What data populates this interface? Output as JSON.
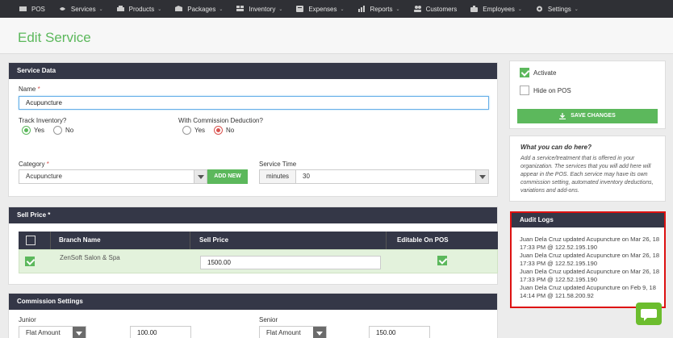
{
  "nav": {
    "items": [
      {
        "label": "POS",
        "icon": "pos-icon",
        "caret": false
      },
      {
        "label": "Services",
        "icon": "services-icon",
        "caret": true
      },
      {
        "label": "Products",
        "icon": "products-icon",
        "caret": true
      },
      {
        "label": "Packages",
        "icon": "packages-icon",
        "caret": true
      },
      {
        "label": "Inventory",
        "icon": "inventory-icon",
        "caret": true
      },
      {
        "label": "Expenses",
        "icon": "expenses-icon",
        "caret": true
      },
      {
        "label": "Reports",
        "icon": "reports-icon",
        "caret": true
      },
      {
        "label": "Customers",
        "icon": "customers-icon",
        "caret": false
      },
      {
        "label": "Employees",
        "icon": "employees-icon",
        "caret": true
      },
      {
        "label": "Settings",
        "icon": "settings-icon",
        "caret": true
      }
    ],
    "caret_glyph": "⌄"
  },
  "page": {
    "title": "Edit Service"
  },
  "service_data": {
    "header": "Service Data",
    "name_label": "Name",
    "required_mark": "*",
    "name_value": "Acupuncture",
    "track_inventory_label": "Track Inventory?",
    "track_yes": "Yes",
    "track_no": "No",
    "commission_deduction_label": "With Commission Deduction?",
    "commission_yes": "Yes",
    "commission_no": "No",
    "category_label": "Category",
    "category_value": "Acupuncture",
    "add_new_label": "ADD NEW",
    "service_time_label": "Service Time",
    "time_unit": "minutes",
    "time_value": "30"
  },
  "sell_price": {
    "header": "Sell Price *",
    "columns": [
      "Branch Name",
      "Sell Price",
      "Editable On POS"
    ],
    "rows": [
      {
        "branch": "ZenSoft Salon & Spa",
        "price": "1500.00"
      }
    ]
  },
  "commission": {
    "header": "Commission Settings",
    "junior_label": "Junior",
    "junior_type": "Flat Amount",
    "junior_value": "100.00",
    "senior_label": "Senior",
    "senior_type": "Flat Amount",
    "senior_value": "150.00"
  },
  "sidebar": {
    "activate_label": "Activate",
    "hide_on_pos_label": "Hide on POS",
    "save_label": "SAVE CHANGES",
    "help_title": "What you can do here?",
    "help_text": "Add a service/treatment that is offered in your organization. The services that you will add here will appear in the POS. Each service may have its own commission setting, automated inventory deductions, variations and add-ons."
  },
  "audit": {
    "header": "Audit Logs",
    "entries": [
      "Juan Dela Cruz updated Acupuncture on Mar 26, 18 17:33 PM @ 122.52.195.190",
      "Juan Dela Cruz updated Acupuncture on Mar 26, 18 17:33 PM @ 122.52.195.190",
      "Juan Dela Cruz updated Acupuncture on Mar 26, 18 17:33 PM @ 122.52.195.190",
      "Juan Dela Cruz updated Acupuncture on Feb 9, 18 14:14 PM @ 121.58.200.92"
    ]
  },
  "colors": {
    "accent": "#5cb85c",
    "nav_bg": "#2f3035",
    "panel_head": "#343747",
    "highlight": "#dd1111"
  }
}
